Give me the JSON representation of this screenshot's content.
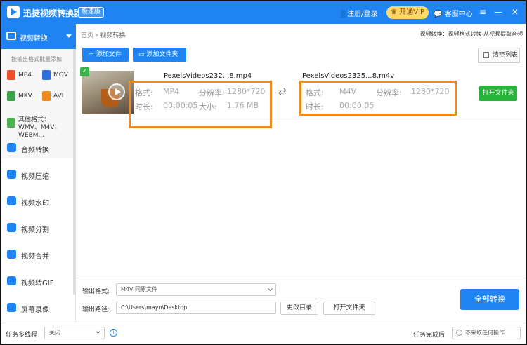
{
  "titlebar": {
    "title": "迅捷视频转换器",
    "edition": "极速版",
    "login": "注册/登录",
    "vip": "开通VIP",
    "service": "客服中心",
    "menu_glyph": "≡",
    "min_glyph": "—",
    "close_glyph": "✕"
  },
  "sidebar": {
    "active": "视频转换",
    "batch_hint": "按输出格式批量添加",
    "formats": [
      {
        "label": "MP4",
        "color": "#e8502c"
      },
      {
        "label": "MOV",
        "color": "#2d6fd8"
      },
      {
        "label": "MKV",
        "color": "#3aa34a"
      },
      {
        "label": "AVI",
        "color": "#f08a1c"
      },
      {
        "label": "其他格式：WMV、M4V、WEBM...",
        "color": "#4caf50"
      }
    ],
    "items": [
      {
        "label": "音频转换",
        "icon": "audio-icon"
      },
      {
        "label": "视频压缩",
        "icon": "compress-icon"
      },
      {
        "label": "视频水印",
        "icon": "watermark-icon"
      },
      {
        "label": "视频分割",
        "icon": "split-icon"
      },
      {
        "label": "视频合并",
        "icon": "merge-icon"
      },
      {
        "label": "视频转GIF",
        "icon": "gif-icon"
      },
      {
        "label": "屏幕录像",
        "icon": "record-icon"
      }
    ]
  },
  "main": {
    "breadcrumb_home": "首页",
    "breadcrumb_sep": "›",
    "breadcrumb_current": "视频转换",
    "route_text": "视频转换：视频格式转换 从视频提取音频",
    "add_file": "添加文件",
    "add_folder": "添加文件夹",
    "clear_list": "清空列表",
    "file": {
      "source_name": "PexelsVideos232...8.mp4",
      "target_name": "PexelsVideos2325...8.m4v",
      "source": {
        "format_label": "格式:",
        "format_value": "MP4",
        "resolution_label": "分辨率:",
        "resolution_value": "1280*720",
        "duration_label": "时长:",
        "duration_value": "00:00:05",
        "size_label": "大小:",
        "size_value": "1.76 MB"
      },
      "target": {
        "format_label": "格式:",
        "format_value": "M4V",
        "resolution_label": "分辨率:",
        "resolution_value": "1280*720",
        "duration_label": "时长:",
        "duration_value": "00:00:05"
      },
      "open_folder": "打开文件夹"
    }
  },
  "settings": {
    "output_format_label": "输出格式:",
    "output_format_value": "M4V  同原文件",
    "output_path_label": "输出路径:",
    "output_path_value": "C:\\Users\\mayn\\Desktop",
    "change_dir": "更改目录",
    "open_folder": "打开文件夹",
    "convert_all": "全部转换"
  },
  "statusbar": {
    "thread_label": "任务多线程",
    "thread_value": "关闭",
    "after_label": "任务完成后",
    "after_value": "不采取任何操作"
  },
  "colors": {
    "accent": "#1f83f2",
    "highlight": "#f28a1a",
    "success": "#27b43a"
  }
}
